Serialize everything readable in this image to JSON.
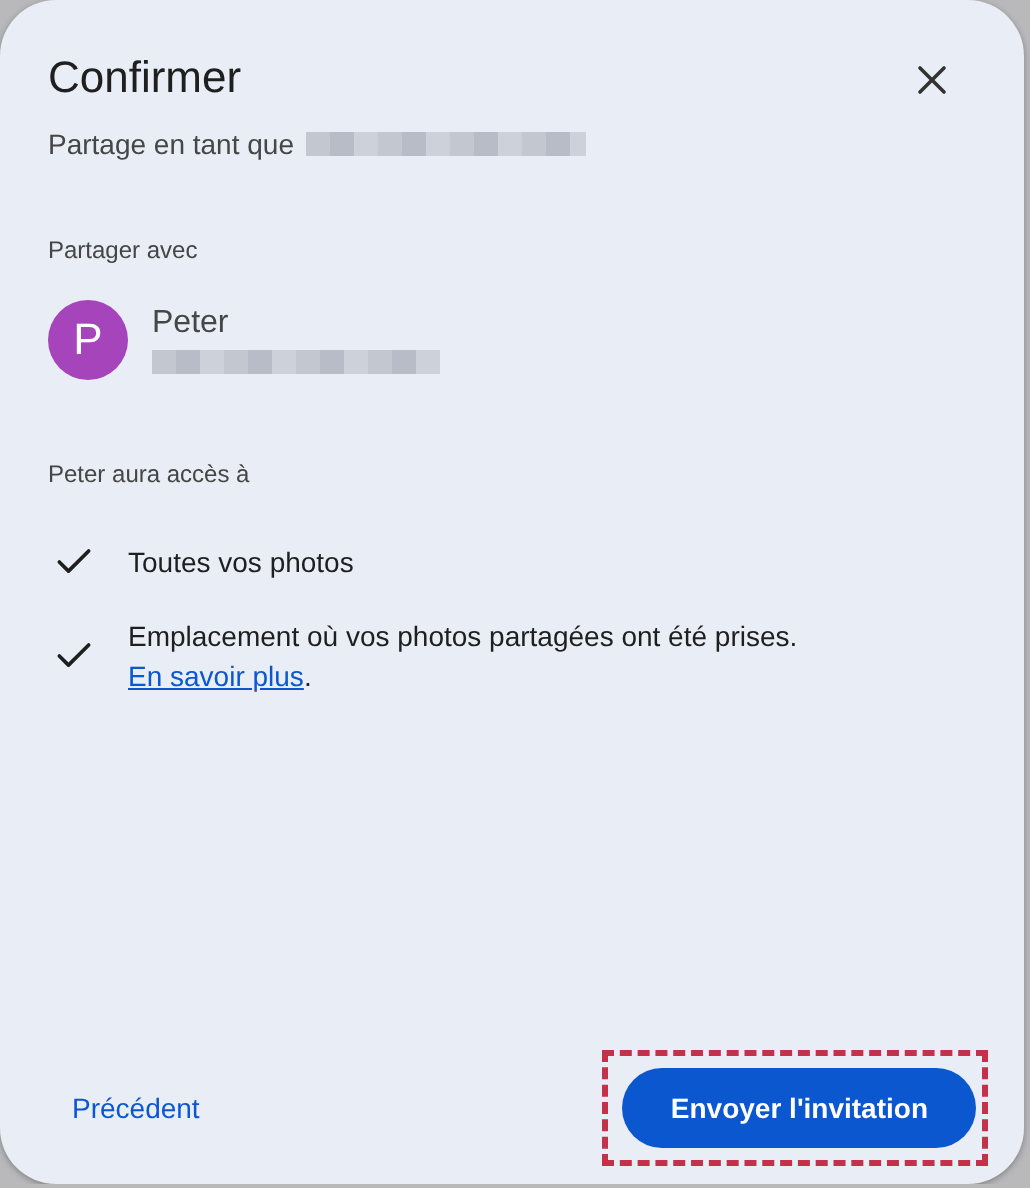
{
  "dialog": {
    "title": "Confirmer",
    "subtitle": "Partage en tant que"
  },
  "share_with": {
    "label": "Partager avec",
    "person": {
      "name": "Peter",
      "initial": "P",
      "color": "#a644bb"
    }
  },
  "access": {
    "label": "Peter aura accès à",
    "items": [
      {
        "text": "Toutes vos photos"
      },
      {
        "text": "Emplacement où vos photos partagées ont été prises.",
        "link": "En savoir plus",
        "after_link": "."
      }
    ]
  },
  "buttons": {
    "back": "Précédent",
    "send": "Envoyer l'invitation"
  }
}
